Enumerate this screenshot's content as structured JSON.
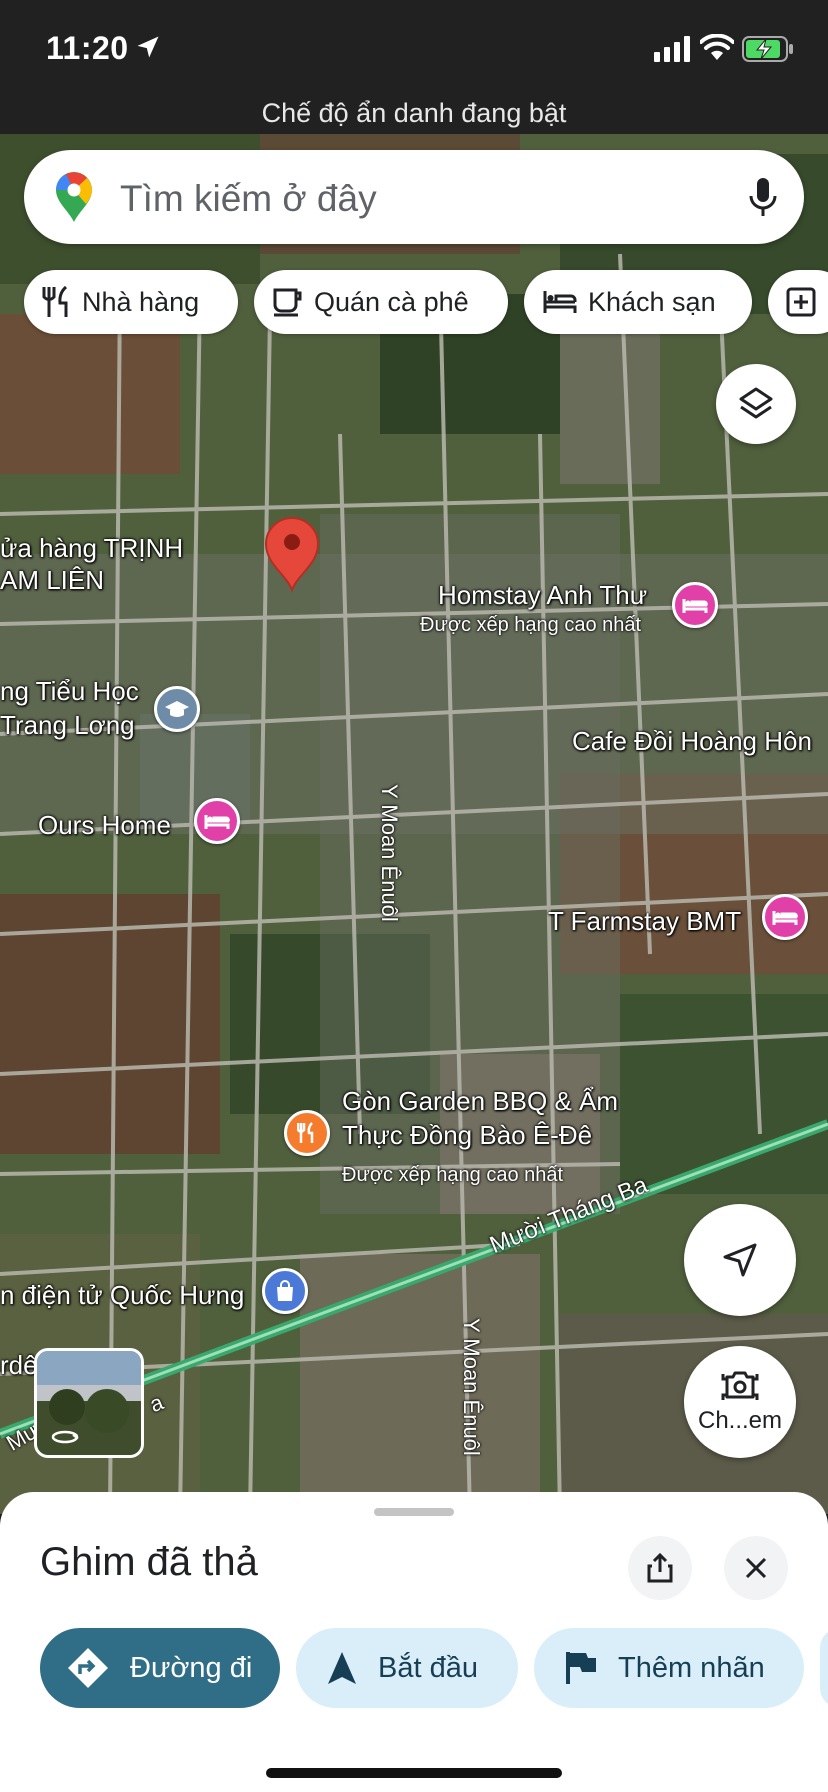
{
  "status_bar": {
    "time": "11:20"
  },
  "incognito": {
    "text": "Chế độ ẩn danh đang bật"
  },
  "search": {
    "placeholder": "Tìm kiếm ở đây"
  },
  "chips": [
    {
      "label": "Nhà hàng",
      "icon": "restaurant-icon"
    },
    {
      "label": "Quán cà phê",
      "icon": "coffee-icon"
    },
    {
      "label": "Khách sạn",
      "icon": "hotel-icon"
    },
    {
      "label": "",
      "icon": "add-box-icon"
    }
  ],
  "map": {
    "places": [
      {
        "name": "ửa hàng TRỊNH\nAM LIÊN"
      },
      {
        "name": "Homstay Anh Thư",
        "sub": "Được xếp hạng cao nhất"
      },
      {
        "name": "ng Tiểu Học\nTrang Lơng"
      },
      {
        "name": "Cafe Đồi Hoàng Hôn"
      },
      {
        "name": "Ours Home"
      },
      {
        "name": "T Farmstay BMT"
      },
      {
        "name": "Gòn Garden BBQ & Ẩm\nThực Đồng Bào Ê-Đê",
        "sub": "Được xếp hạng cao nhất"
      },
      {
        "name": "n điện tử Quốc Hưng"
      },
      {
        "name": "rdê"
      }
    ],
    "roads": {
      "y_moan_1": "Y Moan Ênuôl",
      "y_moan_2": "Y Moan Ênuôl",
      "muoi_thang_ba": "Mười Tháng Ba",
      "muoi_left": "Mườ",
      "a_label": "a"
    }
  },
  "controls": {
    "lens_label": "Ch...em"
  },
  "sheet": {
    "title": "Ghim đã thả",
    "actions": [
      {
        "label": "Đường đi",
        "icon": "directions-icon"
      },
      {
        "label": "Bắt đầu",
        "icon": "navigation-icon"
      },
      {
        "label": "Thêm nhãn",
        "icon": "flag-icon"
      }
    ]
  },
  "colors": {
    "accent": "#2f6e86",
    "pin": "#e5483b",
    "hotel": "#e040a8"
  }
}
